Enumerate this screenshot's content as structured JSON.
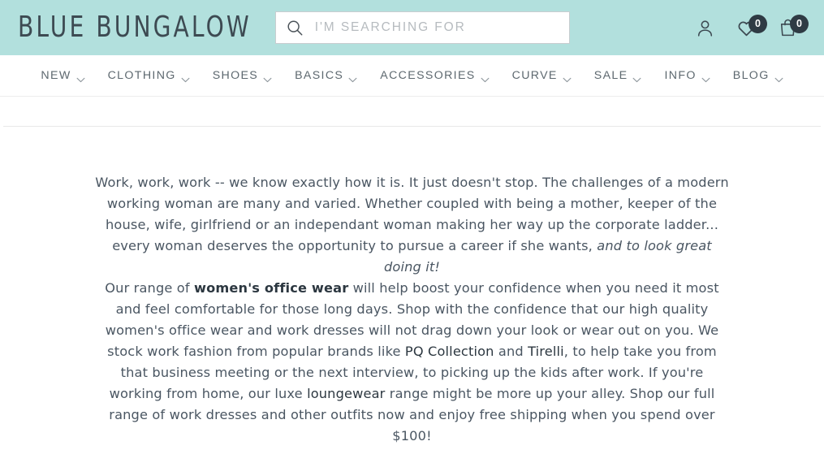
{
  "header": {
    "logo": "BLUE BUNGALOW",
    "logo_color": "#3d4a52",
    "background_color": "#b2e0dd",
    "search": {
      "placeholder": "I'M SEARCHING FOR",
      "value": "",
      "icon": "search-icon"
    },
    "icons": [
      {
        "name": "account-icon",
        "label": "Account",
        "badge": null
      },
      {
        "name": "wishlist-heart-icon",
        "label": "Wishlist",
        "badge": "0"
      },
      {
        "name": "shopping-bag-icon",
        "label": "Bag",
        "badge": "0"
      }
    ],
    "badge_color": "#2f3b44"
  },
  "nav": {
    "items": [
      {
        "label": "NEW",
        "has_dropdown": true
      },
      {
        "label": "CLOTHING",
        "has_dropdown": true
      },
      {
        "label": "SHOES",
        "has_dropdown": true
      },
      {
        "label": "BASICS",
        "has_dropdown": true
      },
      {
        "label": "ACCESSORIES",
        "has_dropdown": true
      },
      {
        "label": "CURVE",
        "has_dropdown": true
      },
      {
        "label": "SALE",
        "has_dropdown": true
      },
      {
        "label": "INFO",
        "has_dropdown": true
      },
      {
        "label": "BLOG",
        "has_dropdown": true
      }
    ]
  },
  "main": {
    "paragraph1": {
      "part1": "Work, work, work -- we know exactly how it is. It just doesn't stop. The challenges of a modern working woman are many and varied. Whether coupled with being a mother, keeper of the house, wife, girlfriend or an independant woman making her way up the corporate ladder... every woman deserves the opportunity to pursue a career if she wants, ",
      "emphasis": "and to look great doing it!"
    },
    "paragraph2": {
      "part1": "Our range of ",
      "link1": "women's office wear",
      "part2": " will help boost your confidence when you need it most and feel comfortable for those long days. Shop with the confidence that our high quality women's office wear and work dresses will not drag down your look or wear out on you. We stock work fashion from popular brands like ",
      "link2": "PQ Collection",
      "part3": " and ",
      "link3": "Tirelli",
      "part4": ", to help take you from that business meeting or the next interview, to picking up the kids after work. If you're working from home, our luxe ",
      "link4": "loungewear",
      "part5": " range might be more up your alley. Shop our full range of work dresses and other outfits now and enjoy free shipping when you spend over $100!"
    }
  }
}
